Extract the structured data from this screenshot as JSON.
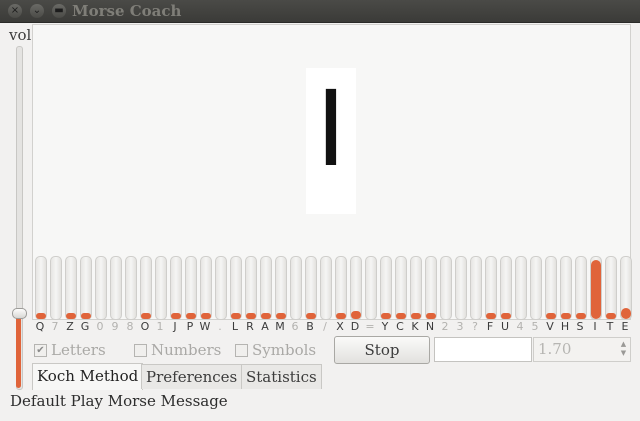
{
  "window": {
    "title": "Morse Coach",
    "close_glyph": "×",
    "minimize_glyph": "⌄",
    "maximize_glyph": "▬"
  },
  "volume": {
    "label": "vol",
    "level_fraction": 0.22
  },
  "current_letter": "I",
  "koch_bars": [
    {
      "label": "Q",
      "level": 0.06,
      "enabled": true
    },
    {
      "label": "7",
      "level": 0,
      "enabled": false
    },
    {
      "label": "Z",
      "level": 0.06,
      "enabled": true
    },
    {
      "label": "G",
      "level": 0.09,
      "enabled": true
    },
    {
      "label": "0",
      "level": 0,
      "enabled": false
    },
    {
      "label": "9",
      "level": 0,
      "enabled": false
    },
    {
      "label": "8",
      "level": 0,
      "enabled": false
    },
    {
      "label": "O",
      "level": 0.06,
      "enabled": true
    },
    {
      "label": "1",
      "level": 0,
      "enabled": false
    },
    {
      "label": "J",
      "level": 0.06,
      "enabled": true
    },
    {
      "label": "P",
      "level": 0.06,
      "enabled": true
    },
    {
      "label": "W",
      "level": 0.09,
      "enabled": true
    },
    {
      "label": ".",
      "level": 0,
      "enabled": false
    },
    {
      "label": "L",
      "level": 0.06,
      "enabled": true
    },
    {
      "label": "R",
      "level": 0.06,
      "enabled": true
    },
    {
      "label": "A",
      "level": 0.06,
      "enabled": true
    },
    {
      "label": "M",
      "level": 0.06,
      "enabled": true
    },
    {
      "label": "6",
      "level": 0,
      "enabled": false
    },
    {
      "label": "B",
      "level": 0.06,
      "enabled": true
    },
    {
      "label": "/",
      "level": 0,
      "enabled": false
    },
    {
      "label": "X",
      "level": 0.06,
      "enabled": true
    },
    {
      "label": "D",
      "level": 0.13,
      "enabled": true
    },
    {
      "label": "=",
      "level": 0,
      "enabled": false
    },
    {
      "label": "Y",
      "level": 0.06,
      "enabled": true
    },
    {
      "label": "C",
      "level": 0.06,
      "enabled": true
    },
    {
      "label": "K",
      "level": 0.06,
      "enabled": true
    },
    {
      "label": "N",
      "level": 0.06,
      "enabled": true
    },
    {
      "label": "2",
      "level": 0,
      "enabled": false
    },
    {
      "label": "3",
      "level": 0,
      "enabled": false
    },
    {
      "label": "?",
      "level": 0,
      "enabled": false
    },
    {
      "label": "F",
      "level": 0.06,
      "enabled": true
    },
    {
      "label": "U",
      "level": 0.06,
      "enabled": true
    },
    {
      "label": "4",
      "level": 0,
      "enabled": false
    },
    {
      "label": "5",
      "level": 0,
      "enabled": false
    },
    {
      "label": "V",
      "level": 0.06,
      "enabled": true
    },
    {
      "label": "H",
      "level": 0.06,
      "enabled": true
    },
    {
      "label": "S",
      "level": 0.06,
      "enabled": true
    },
    {
      "label": "I",
      "level": 0.95,
      "enabled": true
    },
    {
      "label": "T",
      "level": 0.06,
      "enabled": true
    },
    {
      "label": "E",
      "level": 0.18,
      "enabled": true
    }
  ],
  "options": {
    "letters": {
      "label": "Letters",
      "checked": true
    },
    "numbers": {
      "label": "Numbers",
      "checked": false
    },
    "symbols": {
      "label": "Symbols",
      "checked": false
    }
  },
  "controls": {
    "stop_label": "Stop",
    "text_entry_value": "",
    "speed_value": "1.70"
  },
  "tabs": [
    {
      "label": "Koch Method",
      "active": true
    },
    {
      "label": "Preferences",
      "active": false
    },
    {
      "label": "Statistics",
      "active": false
    }
  ],
  "status": "Default Play Morse Message",
  "colors": {
    "accent": "#e0643a",
    "titlebar": "#3f3f3c",
    "background": "#f2f1f0"
  }
}
